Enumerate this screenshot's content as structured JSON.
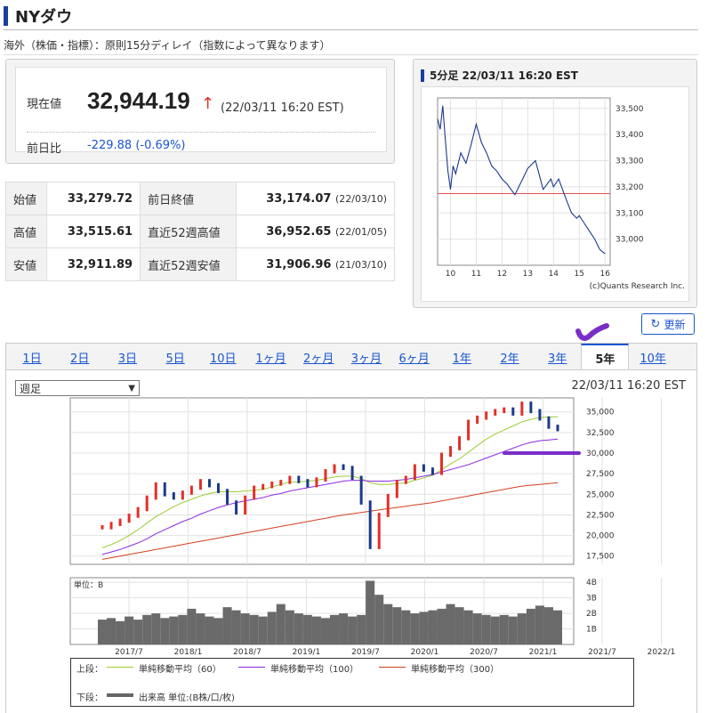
{
  "page": {
    "title": "NYダウ",
    "note": "海外（株価・指標）：原則15分ディレイ（指数によって異なります）"
  },
  "price": {
    "label": "現在値",
    "value": "32,944.19",
    "arrow": "↑",
    "time": "(22/03/11 16:20 EST)",
    "change_label": "前日比",
    "change": "-229.88",
    "change_pct": "(-0.69%)"
  },
  "stats": [
    {
      "l1": "始値",
      "v1": "33,279.72",
      "l2": "前日終値",
      "v2": "33,174.07",
      "d2": "(22/03/10)"
    },
    {
      "l1": "高値",
      "v1": "33,515.61",
      "l2": "直近52週高値",
      "v2": "36,952.65",
      "d2": "(22/01/05)"
    },
    {
      "l1": "安値",
      "v1": "32,911.89",
      "l2": "直近52週安値",
      "v2": "31,906.96",
      "d2": "(21/03/10)"
    }
  ],
  "mini": {
    "title": "5分足 22/03/11 16:20 EST",
    "credit": "(c)Quants Research Inc."
  },
  "update_label": "更新",
  "tabs": [
    "1日",
    "2日",
    "3日",
    "5日",
    "10日",
    "1ヶ月",
    "2ヶ月",
    "3ヶ月",
    "6ヶ月",
    "1年",
    "2年",
    "3年",
    "5年",
    "10年"
  ],
  "active_tab": 12,
  "period_select": "週足",
  "main_time": "22/03/11 16:20 EST",
  "legend": {
    "upper": "上段：",
    "ma60": "単純移動平均（60）",
    "ma100": "単純移動平均（100）",
    "ma300": "単純移動平均（300）",
    "lower": "下段：",
    "vol": "出来高 単位:(B株/口/枚)"
  },
  "volume_unit": "単位：B",
  "colors": {
    "accent": "#1a55d0",
    "up": "#e0302a",
    "ma60": "#9acd32",
    "ma100": "#8a2be2",
    "ma300": "#d2401e",
    "hline": "#e05050"
  },
  "chart_data": [
    {
      "type": "line",
      "title": "5分足 22/03/11 16:20 EST",
      "x_ticks": [
        "10",
        "11",
        "12",
        "13",
        "14",
        "15",
        "16"
      ],
      "y_ticks": [
        "33,500",
        "33,400",
        "33,300",
        "33,200",
        "33,100",
        "33,000"
      ],
      "ylim": [
        32900,
        33540
      ],
      "x": [
        9.5,
        9.6,
        9.7,
        9.8,
        9.9,
        10.0,
        10.1,
        10.2,
        10.4,
        10.6,
        10.8,
        11.0,
        11.2,
        11.4,
        11.6,
        11.8,
        12.0,
        12.2,
        12.5,
        12.8,
        13.0,
        13.3,
        13.6,
        13.9,
        14.0,
        14.2,
        14.5,
        14.7,
        14.9,
        15.0,
        15.2,
        15.4,
        15.6,
        15.8,
        16.0
      ],
      "y": [
        33460,
        33420,
        33510,
        33380,
        33260,
        33190,
        33280,
        33250,
        33330,
        33290,
        33360,
        33440,
        33370,
        33330,
        33280,
        33260,
        33230,
        33210,
        33170,
        33230,
        33270,
        33300,
        33190,
        33230,
        33200,
        33230,
        33150,
        33100,
        33080,
        33090,
        33060,
        33030,
        33000,
        32960,
        32944
      ],
      "reference_line": 33174.07
    },
    {
      "type": "line",
      "title": "5年 週足",
      "x_ticks": [
        "2017/7",
        "2018/1",
        "2018/7",
        "2019/1",
        "2019/7",
        "2020/1",
        "2020/7",
        "2021/1",
        "2021/7",
        "2022/1"
      ],
      "y_ticks": [
        "35,000",
        "32,500",
        "30,000",
        "27,500",
        "25,000",
        "22,500",
        "20,000",
        "17,500"
      ],
      "ylim": [
        16500,
        36700
      ],
      "series": [
        {
          "name": "",
          "values": [
            21000,
            21400,
            21800,
            22400,
            23200,
            24600,
            26200,
            25000,
            24600,
            25200,
            25800,
            26600,
            26100,
            25400,
            24000,
            22800,
            24600,
            25800,
            26000,
            26300,
            26500,
            27000,
            26600,
            26100,
            26800,
            27800,
            28400,
            28200,
            27000,
            24000,
            18600,
            22500,
            24800,
            26500,
            27000,
            28400,
            28000,
            27600,
            29800,
            30600,
            31800,
            33800,
            34300,
            34800,
            35100,
            35300,
            34800,
            36000,
            35100,
            34200,
            33200,
            32900
          ]
        },
        {
          "name": "単純移動平均（60）",
          "values": [
            18500,
            18900,
            19400,
            20000,
            20700,
            21500,
            22300,
            22900,
            23500,
            24000,
            24400,
            24800,
            25100,
            25300,
            25300,
            25300,
            25400,
            25500,
            25600,
            25900,
            26200,
            26500,
            26500,
            26600,
            26700,
            26900,
            27100,
            27200,
            27200,
            26900,
            26400,
            26200,
            26200,
            26300,
            26400,
            26700,
            27000,
            27300,
            28000,
            28700,
            29300,
            30100,
            30900,
            31700,
            32300,
            32800,
            33300,
            33800,
            34100,
            34300,
            34400,
            34400
          ]
        },
        {
          "name": "単純移動平均（100）",
          "values": [
            17700,
            18000,
            18300,
            18700,
            19100,
            19600,
            20200,
            20700,
            21200,
            21700,
            22100,
            22600,
            23000,
            23400,
            23700,
            24000,
            24200,
            24400,
            24600,
            24900,
            25100,
            25400,
            25600,
            25800,
            26000,
            26200,
            26400,
            26600,
            26700,
            26700,
            26600,
            26600,
            26600,
            26700,
            26800,
            27000,
            27200,
            27400,
            27700,
            28000,
            28300,
            28600,
            29000,
            29400,
            29800,
            30200,
            30600,
            31000,
            31300,
            31500,
            31600,
            31700
          ]
        },
        {
          "name": "単純移動平均（300）",
          "values": [
            17100,
            17300,
            17500,
            17700,
            17900,
            18100,
            18300,
            18500,
            18700,
            18900,
            19100,
            19300,
            19500,
            19700,
            19900,
            20100,
            20300,
            20500,
            20700,
            20900,
            21100,
            21300,
            21500,
            21700,
            21900,
            22100,
            22300,
            22500,
            22650,
            22800,
            22950,
            23100,
            23250,
            23400,
            23550,
            23700,
            23850,
            24000,
            24200,
            24400,
            24600,
            24800,
            25000,
            25200,
            25400,
            25600,
            25800,
            26000,
            26100,
            26200,
            26300,
            26400
          ]
        }
      ]
    },
    {
      "type": "bar",
      "title": "出来高",
      "y_ticks": [
        "4B",
        "3B",
        "2B",
        "1B"
      ],
      "ylim": [
        0,
        4.3
      ],
      "values": [
        1.6,
        1.7,
        1.5,
        1.8,
        1.6,
        1.9,
        2.0,
        1.7,
        1.8,
        1.9,
        2.3,
        2.0,
        1.8,
        1.7,
        2.4,
        2.2,
        2.0,
        1.9,
        1.8,
        2.1,
        2.6,
        2.2,
        2.0,
        1.9,
        1.8,
        1.7,
        1.9,
        2.0,
        1.8,
        1.9,
        4.1,
        3.2,
        2.6,
        2.4,
        2.2,
        2.0,
        2.1,
        2.2,
        2.3,
        2.6,
        2.4,
        2.2,
        2.0,
        1.9,
        1.8,
        1.9,
        1.8,
        2.0,
        2.3,
        2.5,
        2.4,
        2.2
      ]
    }
  ]
}
